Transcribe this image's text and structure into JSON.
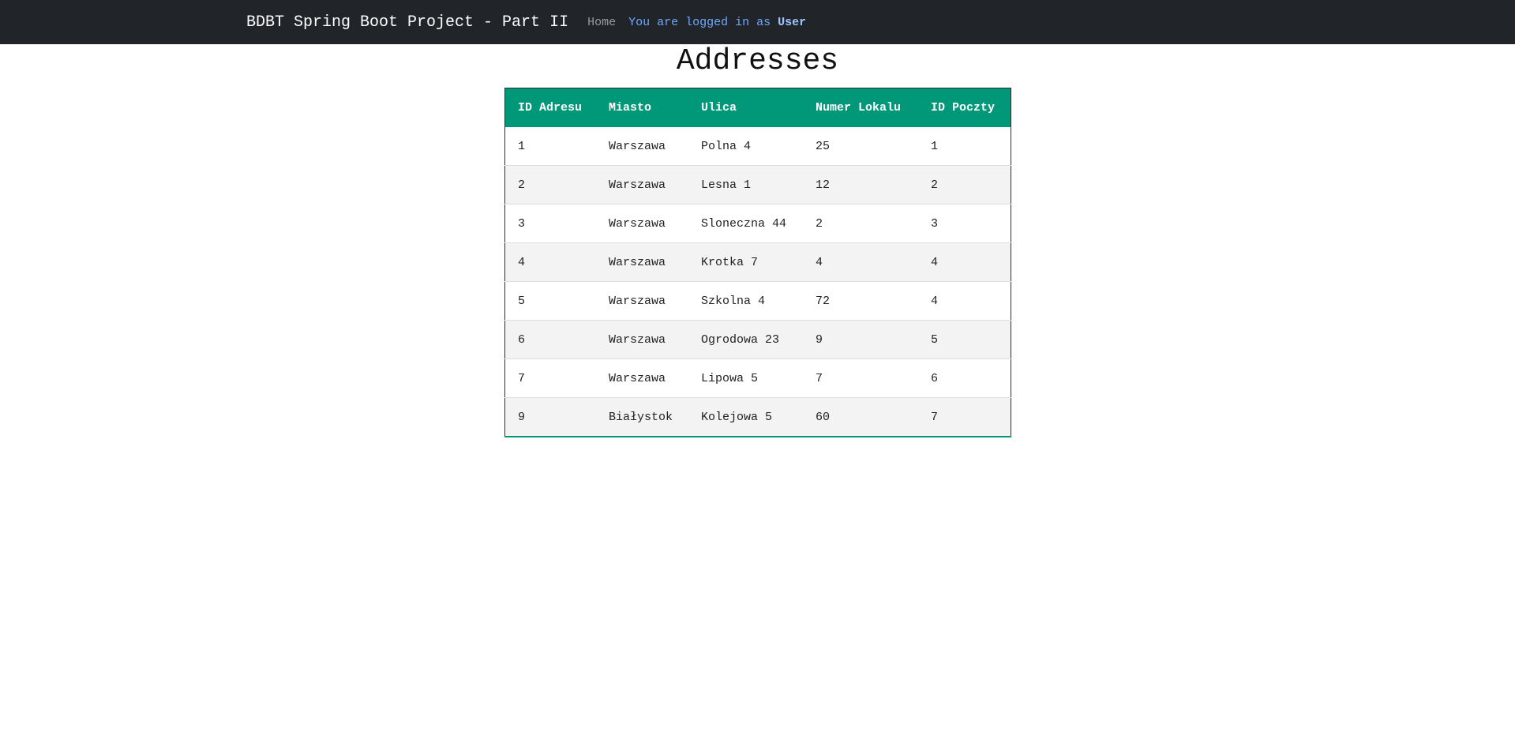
{
  "navbar": {
    "brand": "BDBT Spring Boot Project - Part II",
    "home_link": "Home",
    "login_prefix": "You are logged in as",
    "login_user": "User"
  },
  "page": {
    "title": "Addresses"
  },
  "table": {
    "headers": [
      "ID Adresu",
      "Miasto",
      "Ulica",
      "Numer Lokalu",
      "ID Poczty"
    ],
    "rows": [
      [
        "1",
        "Warszawa",
        "Polna 4",
        "25",
        "1"
      ],
      [
        "2",
        "Warszawa",
        "Lesna 1",
        "12",
        "2"
      ],
      [
        "3",
        "Warszawa",
        "Sloneczna 44",
        "2",
        "3"
      ],
      [
        "4",
        "Warszawa",
        "Krotka 7",
        "4",
        "4"
      ],
      [
        "5",
        "Warszawa",
        "Szkolna 4",
        "72",
        "4"
      ],
      [
        "6",
        "Warszawa",
        "Ogrodowa 23",
        "9",
        "5"
      ],
      [
        "7",
        "Warszawa",
        "Lipowa 5",
        "7",
        "6"
      ],
      [
        "9",
        "Białystok",
        "Kolejowa 5",
        "60",
        "7"
      ]
    ]
  },
  "colors": {
    "navbar_bg": "#212529",
    "table_header_bg": "#009879",
    "login_text": "#6ea8fe",
    "row_stripe": "#f3f3f3"
  }
}
